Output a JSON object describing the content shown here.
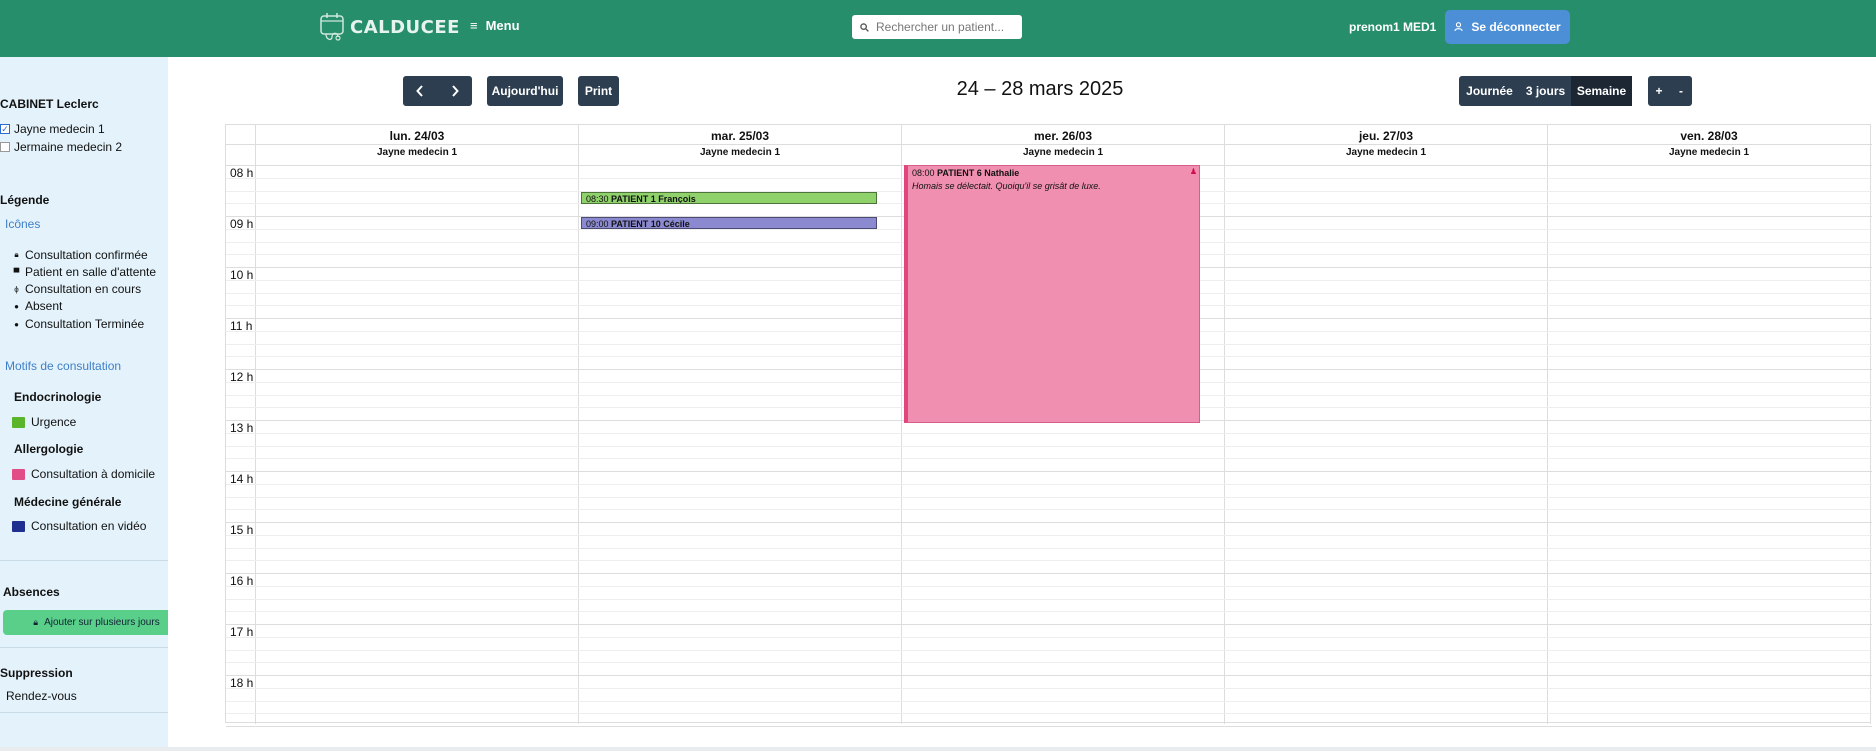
{
  "header": {
    "logo_text": "CALDUCEE",
    "menu_label": "Menu",
    "search_placeholder": "Rechercher un patient...",
    "user_name": "prenom1 MED1",
    "logout_label": "Se déconnecter",
    "colors": {
      "bar": "#268e6a",
      "logout": "#4d8fd6"
    }
  },
  "sidebar": {
    "cabinet": "CABINET Leclerc",
    "practitioners": [
      {
        "label": "Jayne medecin 1",
        "checked": true
      },
      {
        "label": "Jermaine medecin 2",
        "checked": false
      }
    ],
    "legend_title": "Légende",
    "icons_section": "Icônes",
    "icons_toggle": "−",
    "icon_items": [
      {
        "icon": "lock-icon",
        "label": "Consultation confirmée"
      },
      {
        "icon": "car-icon",
        "label": "Patient en salle d'attente"
      },
      {
        "icon": "stethoscope-icon",
        "label": "Consultation en cours"
      },
      {
        "icon": "question-circle-icon",
        "label": "Absent"
      },
      {
        "icon": "check-circle-icon",
        "label": "Consultation Terminée"
      }
    ],
    "motifs_section": "Motifs de consultation",
    "motifs_toggle": "−",
    "categories": [
      {
        "name": "Endocrinologie",
        "motif": "Urgence",
        "color": "#5ab52a"
      },
      {
        "name": "Allergologie",
        "motif": "Consultation à domicile",
        "color": "#e14d87"
      },
      {
        "name": "Médecine générale",
        "motif": "Consultation en vidéo",
        "color": "#1f2f8f"
      }
    ],
    "absences_title": "Absences",
    "add_absence_label": "Ajouter sur plusieurs jours",
    "suppression_title": "Suppression",
    "suppression_value": "Rendez-vous"
  },
  "toolbar": {
    "prev": "‹",
    "next": "›",
    "today": "Aujourd'hui",
    "print": "Print",
    "range": "24 – 28 mars 2025",
    "views": [
      "Journée",
      "3 jours",
      "Semaine"
    ],
    "active_view": "Semaine",
    "zoom_in": "+",
    "zoom_out": "-"
  },
  "calendar": {
    "days": [
      {
        "label": "lun. 24/03",
        "resource": "Jayne medecin 1"
      },
      {
        "label": "mar. 25/03",
        "resource": "Jayne medecin 1"
      },
      {
        "label": "mer. 26/03",
        "resource": "Jayne medecin 1"
      },
      {
        "label": "jeu. 27/03",
        "resource": "Jayne medecin 1"
      },
      {
        "label": "ven. 28/03",
        "resource": "Jayne medecin 1"
      }
    ],
    "hours": [
      "08 h",
      "09 h",
      "10 h",
      "11 h",
      "12 h",
      "13 h",
      "14 h",
      "15 h",
      "16 h",
      "17 h",
      "18 h"
    ],
    "events": [
      {
        "day": 1,
        "time": "08:30",
        "title": "PATIENT 1 François",
        "color": "#8fd16a"
      },
      {
        "day": 1,
        "time": "09:00",
        "title": "PATIENT 10 Cécile",
        "color": "#8b8ad0"
      },
      {
        "day": 2,
        "time": "08:00",
        "title": "PATIENT 6 Nathalie",
        "description": "Homais se délectait. Quoiqu'il se grisât de luxe.",
        "color": "#f08fb0"
      }
    ]
  }
}
